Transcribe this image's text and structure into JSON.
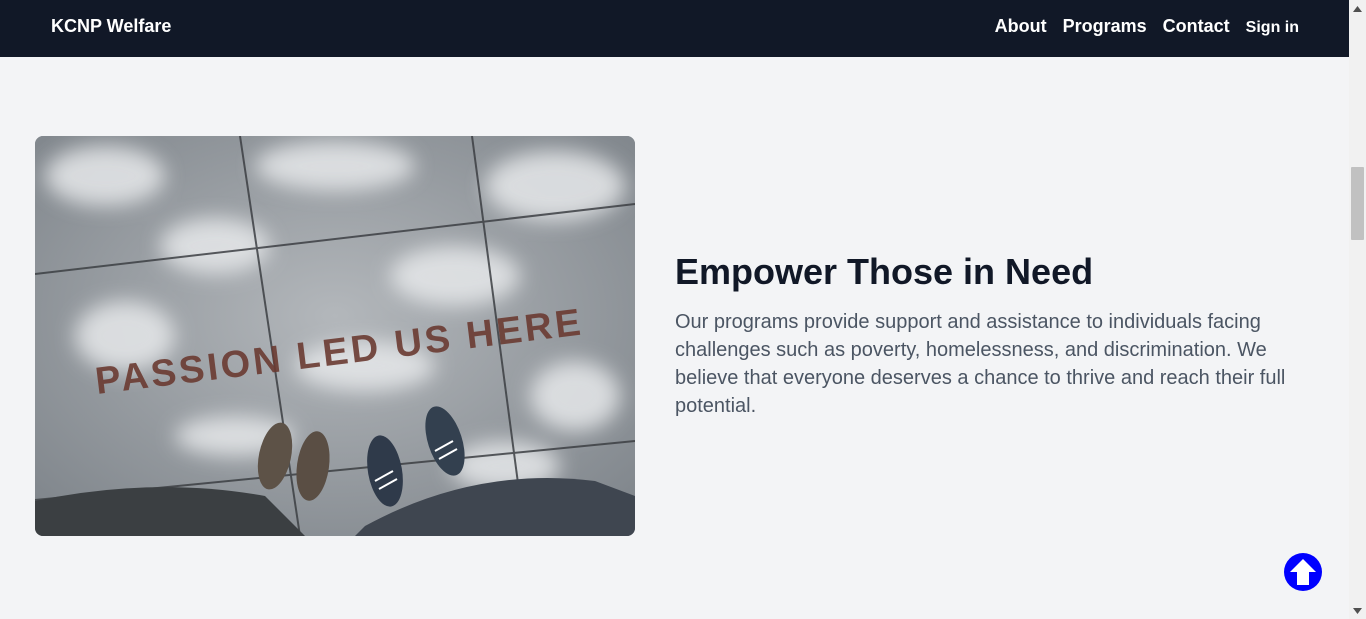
{
  "nav": {
    "brand": "KCNP Welfare",
    "links": [
      {
        "label": "About"
      },
      {
        "label": "Programs"
      },
      {
        "label": "Contact"
      },
      {
        "label": "Sign in"
      }
    ]
  },
  "hero": {
    "image_text": "PASSION LED US HERE",
    "headline": "Empower Those in Need",
    "description": "Our programs provide support and assistance to individuals facing challenges such as poverty, homelessness, and discrimination. We believe that everyone deserves a chance to thrive and reach their full potential."
  },
  "icons": {
    "back_to_top": "arrow-up-circle-icon",
    "scroll_up": "triangle-up-icon",
    "scroll_down": "triangle-down-icon"
  },
  "colors": {
    "navbar": "#111827",
    "page_background": "#f3f4f6",
    "headline": "#111827",
    "body_text": "#4b5563",
    "back_to_top": "#0000ff"
  }
}
